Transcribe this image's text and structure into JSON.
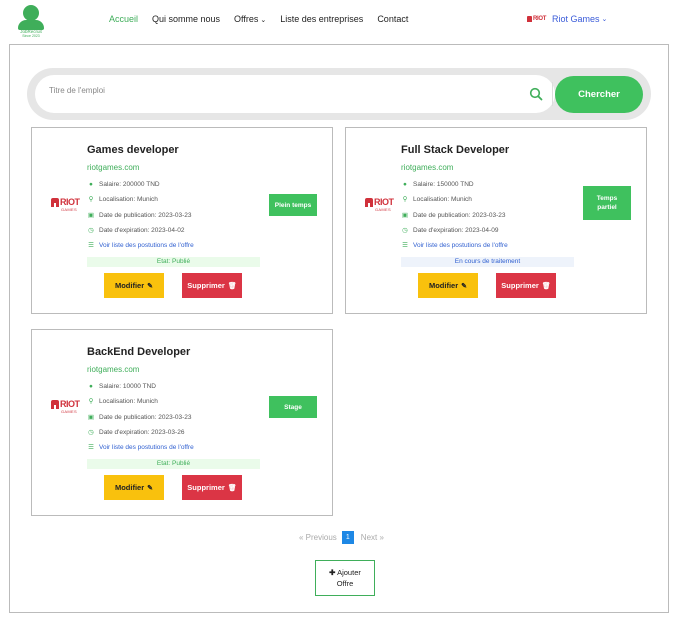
{
  "logo": {
    "brand": "JobRecruit",
    "tagline": "Since 2023"
  },
  "nav": {
    "items": [
      {
        "label": "Accueil",
        "active": true
      },
      {
        "label": "Qui somme nous"
      },
      {
        "label": "Offres",
        "dropdown": true
      },
      {
        "label": "Liste des entreprises"
      },
      {
        "label": "Contact"
      }
    ],
    "user": {
      "name": "Riot Games",
      "logo_text": "RIOT"
    }
  },
  "search": {
    "placeholder": "Titre de l'emploi",
    "value": "",
    "button_label": "Chercher"
  },
  "company_logo": {
    "text": "RIOT",
    "subtext": "GAMES"
  },
  "offers": [
    {
      "title": "Games developer",
      "site": "riotgames.com",
      "salary": "Salaire: 200000 TND",
      "location": "Localisation: Munich",
      "published": "Date de publication: 2023-03-23",
      "expires": "Date d'expiration: 2023-04-02",
      "applications_link": "Voir liste des postutions de l'offre",
      "contract": "Plein temps",
      "status": "Etat: Publié",
      "status_kind": "published",
      "edit_label": "Modifier",
      "delete_label": "Supprimer"
    },
    {
      "title": "Full Stack Developer",
      "site": "riotgames.com",
      "salary": "Salaire: 150000 TND",
      "location": "Localisation: Munich",
      "published": "Date de publication: 2023-03-23",
      "expires": "Date d'expiration: 2023-04-09",
      "applications_link": "Voir liste des postutions de l'offre",
      "contract": "Temps partiel",
      "status": "En cours de traitement",
      "status_kind": "processing",
      "edit_label": "Modifier",
      "delete_label": "Supprimer"
    },
    {
      "title": "BackEnd Developer",
      "site": "riotgames.com",
      "salary": "Salaire: 10000 TND",
      "location": "Localisation: Munich",
      "published": "Date de publication: 2023-03-23",
      "expires": "Date d'expiration: 2023-03-26",
      "applications_link": "Voir liste des postutions de l'offre",
      "contract": "Stage",
      "status": "Etat: Publié",
      "status_kind": "published",
      "edit_label": "Modifier",
      "delete_label": "Supprimer"
    }
  ],
  "pagination": {
    "previous": "« Previous",
    "current": "1",
    "next": "Next »"
  },
  "add_offer": {
    "icon": "plus-icon",
    "label_line1": "Ajouter",
    "label_line2": "Offre"
  },
  "colors": {
    "accent": "#3fae5a",
    "primary_button": "#3fc15e",
    "edit": "#f9c10d",
    "delete": "#db3545",
    "link": "#2f5fd0",
    "page_active": "#1e88e5"
  }
}
